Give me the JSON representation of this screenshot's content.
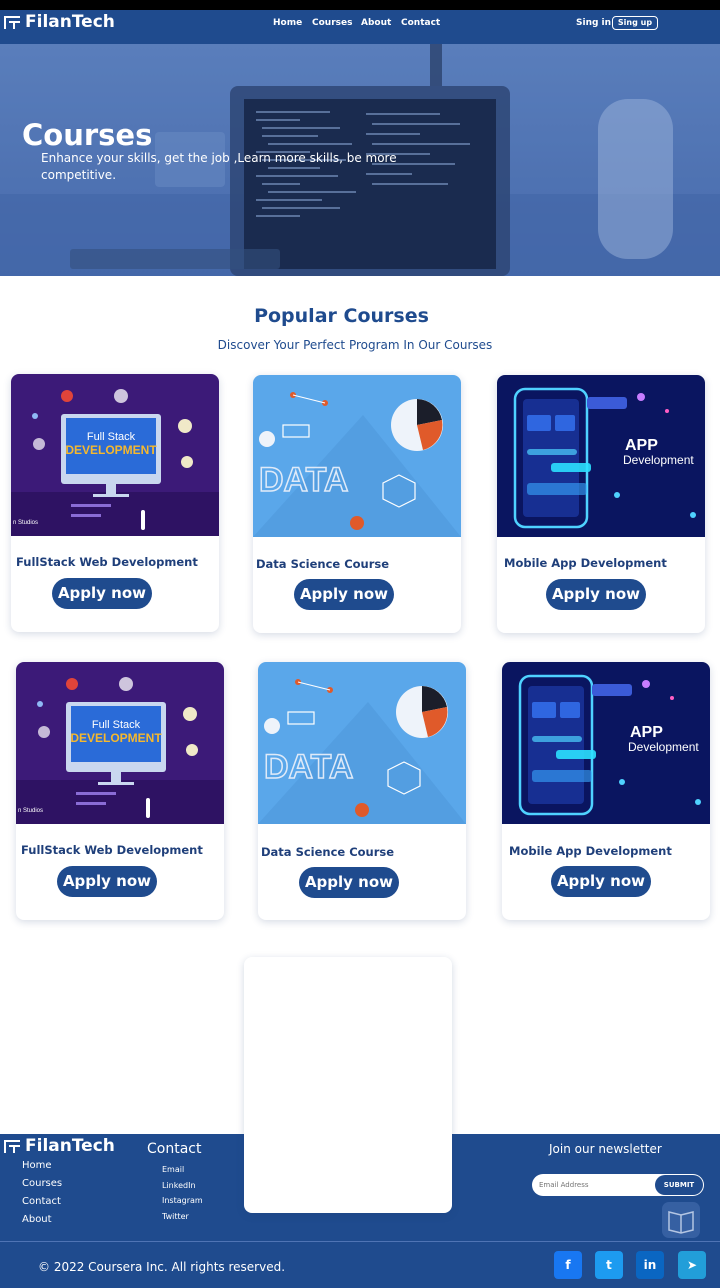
{
  "brand": {
    "name": "FilanTech"
  },
  "nav": {
    "links": [
      "Home",
      "Courses",
      "About",
      "Contact"
    ],
    "signin_label": "Sing in",
    "signup_label": "Sing up"
  },
  "hero": {
    "title": "Courses",
    "subtitle": "Enhance your skills, get the job ,Learn more skills, be more competitive."
  },
  "popular": {
    "title": "Popular Courses",
    "subtitle": "Discover Your Perfect Program In Our Courses"
  },
  "thumb_text": {
    "fullstack_top": "Full Stack",
    "fullstack_bottom": "DEVELOPMENT",
    "data": "DATA",
    "app": "APP",
    "app_sub": "Development",
    "studio": "n Studios"
  },
  "courses": [
    {
      "title": "FullStack Web Development",
      "button": "Apply now",
      "thumb": "fullstack"
    },
    {
      "title": "Data Science Course",
      "button": "Apply now",
      "thumb": "data"
    },
    {
      "title": "Mobile App  Development",
      "button": "Apply now",
      "thumb": "app"
    },
    {
      "title": "FullStack Web Development",
      "button": "Apply now",
      "thumb": "fullstack"
    },
    {
      "title": "Data Science Course",
      "button": "Apply now",
      "thumb": "data"
    },
    {
      "title": "Mobile App  Development",
      "button": "Apply now",
      "thumb": "app"
    }
  ],
  "footer": {
    "links": [
      "Home",
      "Courses",
      "Contact",
      "About"
    ],
    "contact_title": "Contact",
    "contact_items": [
      "Email",
      "LinkedIn",
      "Instagram",
      "Twitter"
    ],
    "newsletter_title": "Join our newsletter",
    "email_placeholder": "Email Address",
    "submit_label": "SUBMIT",
    "copyright": "© 2022 Coursera Inc. All rights reserved.",
    "social": [
      {
        "icon": "facebook-icon",
        "color": "#1877f2",
        "glyph": "f"
      },
      {
        "icon": "twitter-icon",
        "color": "#1d9bf0",
        "glyph": "t"
      },
      {
        "icon": "linkedin-icon",
        "color": "#0a66c2",
        "glyph": "in"
      },
      {
        "icon": "telegram-icon",
        "color": "#229ed9",
        "glyph": "➤"
      }
    ]
  },
  "colors": {
    "primary": "#1f4b8e",
    "accent_yellow": "#f5b82e",
    "data_bg": "#5aa7ea",
    "app_bg": "#0a1560",
    "fullstack_bg": "#3c1a78"
  }
}
